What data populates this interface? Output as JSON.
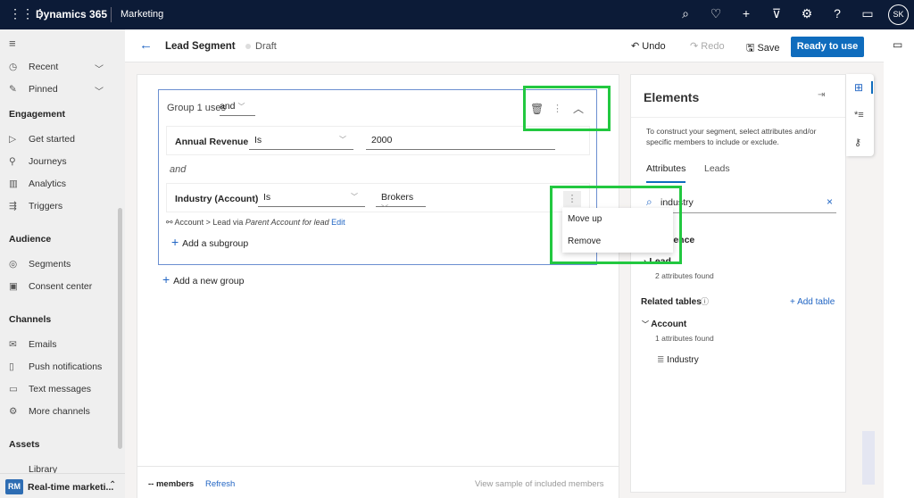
{
  "topbar": {
    "brand": "Dynamics 365",
    "app": "Marketing",
    "user_initials": "SK",
    "icons": [
      "search-icon",
      "lightbulb-icon",
      "plus-icon",
      "filter-icon",
      "gear-icon",
      "help-icon",
      "chat-icon"
    ]
  },
  "sidebar": {
    "recent": "Recent",
    "pinned": "Pinned",
    "sections": [
      {
        "title": "Engagement",
        "items": [
          "Get started",
          "Journeys",
          "Analytics",
          "Triggers"
        ]
      },
      {
        "title": "Audience",
        "items": [
          "Segments",
          "Consent center"
        ]
      },
      {
        "title": "Channels",
        "items": [
          "Emails",
          "Push notifications",
          "Text messages",
          "More channels"
        ]
      },
      {
        "title": "Assets",
        "items": [
          "Library"
        ]
      }
    ],
    "area": {
      "badge": "RM",
      "label": "Real-time marketi..."
    }
  },
  "header": {
    "title": "Lead Segment",
    "status": "Draft",
    "undo": "Undo",
    "redo": "Redo",
    "save": "Save",
    "ready": "Ready to use"
  },
  "group": {
    "label": "Group 1 uses",
    "operator": "and",
    "connector": "and",
    "conditions": [
      {
        "attribute": "Annual Revenue",
        "op": "Is",
        "value": "2000"
      },
      {
        "attribute": "Industry (Account)",
        "op": "Is",
        "value": "Brokers"
      }
    ],
    "path_prefix": "Account > Lead via",
    "path_relation": "Parent Account for lead",
    "path_edit": "Edit",
    "add_subgroup": "Add a subgroup",
    "menu": [
      "Move up",
      "Remove"
    ]
  },
  "add_group": "Add a new group",
  "footer": {
    "members": "-- members",
    "refresh": "Refresh",
    "sample": "View sample of included members"
  },
  "elements": {
    "title": "Elements",
    "description": "To construct your segment, select attributes and/or specific members to include or exclude.",
    "tabs": [
      "Attributes",
      "Leads"
    ],
    "search_value": "industry",
    "audience": "Audience",
    "lead": "Lead",
    "lead_found": "2 attributes found",
    "related": "Related tables",
    "add_table": "+ Add table",
    "account": "Account",
    "account_found": "1 attributes found",
    "attribute": "Industry"
  },
  "colors": {
    "topbar": "#0c1b37",
    "accent": "#0f6cbd",
    "highlight": "#22c840"
  }
}
